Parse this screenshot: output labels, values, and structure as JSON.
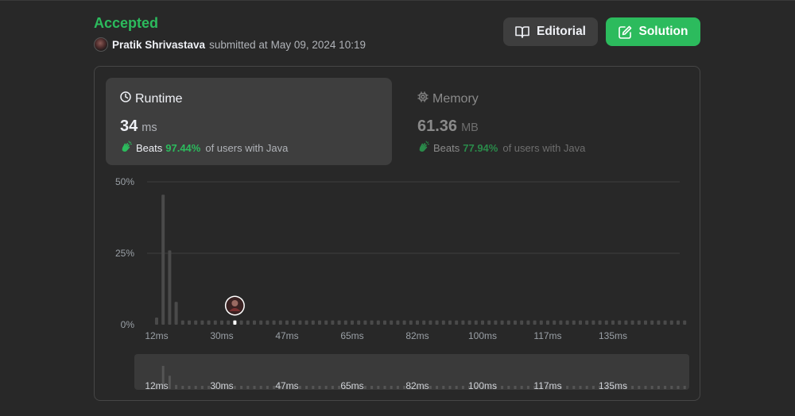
{
  "submission": {
    "status": "Accepted",
    "user_name": "Pratik Shrivastava",
    "submitted_text": "submitted at",
    "date": "May 09, 2024 10:19"
  },
  "buttons": {
    "editorial_label": "Editorial",
    "solution_label": "Solution"
  },
  "runtime": {
    "title": "Runtime",
    "value": "34",
    "unit": "ms",
    "beats_label": "Beats",
    "beats_pct": "97.44%",
    "beats_suffix": "of users with Java"
  },
  "memory": {
    "title": "Memory",
    "value": "61.36",
    "unit": "MB",
    "beats_label": "Beats",
    "beats_pct": "77.94%",
    "beats_suffix": "of users with Java"
  },
  "colors": {
    "accent": "#2cbb5d",
    "bar": "#4a4a4a",
    "bar_active": "#ffffff",
    "grid": "#3e3e3e"
  },
  "chart_data": {
    "type": "bar",
    "yticks": [
      "50%",
      "25%",
      "0%"
    ],
    "ylim": [
      0,
      50
    ],
    "xtick_labels": [
      "12ms",
      "30ms",
      "47ms",
      "65ms",
      "82ms",
      "100ms",
      "117ms",
      "135ms"
    ],
    "bin_count": 82,
    "highlight_bin": 12,
    "values": [
      2.5,
      45.5,
      26,
      8,
      1.5,
      1.5,
      1.5,
      1.5,
      1.5,
      1.5,
      1.5,
      1.5,
      1.5,
      1.5,
      1.5,
      1.5,
      1.5,
      1.5,
      1.5,
      1.5,
      1.5,
      1.5,
      1.5,
      1.5,
      1.5,
      1.5,
      1.5,
      1.5,
      1.5,
      1.5,
      1.5,
      1.5,
      1.5,
      1.5,
      1.5,
      1.5,
      1.5,
      1.5,
      1.5,
      1.5,
      1.5,
      1.5,
      1.5,
      1.5,
      1.5,
      1.5,
      1.5,
      1.5,
      1.5,
      1.5,
      1.5,
      1.5,
      1.5,
      1.5,
      1.5,
      1.5,
      1.5,
      1.5,
      1.5,
      1.5,
      1.5,
      1.5,
      1.5,
      1.5,
      1.5,
      1.5,
      1.5,
      1.5,
      1.5,
      1.5,
      1.5,
      1.5,
      1.5,
      1.5,
      1.5,
      1.5,
      1.5,
      1.5,
      1.5,
      1.5,
      1.5,
      1.5
    ],
    "grid": true
  }
}
